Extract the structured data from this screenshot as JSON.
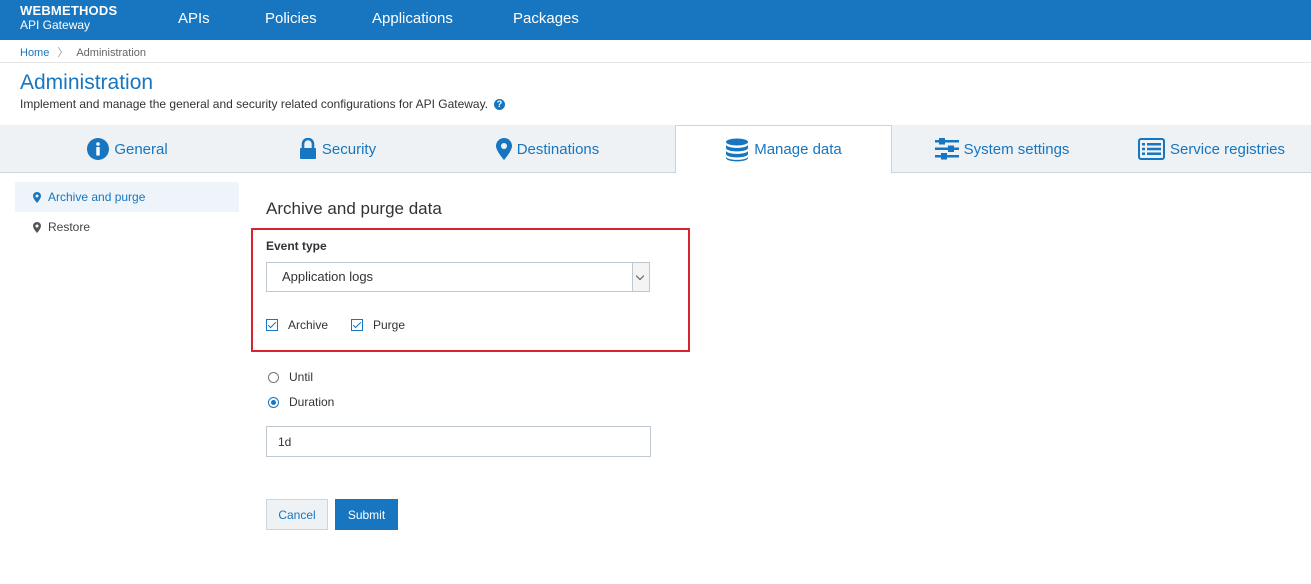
{
  "app": {
    "brand_line1": "WEBMETHODS",
    "brand_line2": "API Gateway"
  },
  "nav": {
    "items": [
      {
        "label": "APIs"
      },
      {
        "label": "Policies"
      },
      {
        "label": "Applications"
      },
      {
        "label": "Packages"
      }
    ]
  },
  "breadcrumb": {
    "home": "Home",
    "separator": "〉",
    "current": "Administration"
  },
  "page": {
    "title": "Administration",
    "description": "Implement and manage the general and security related configurations for API Gateway.",
    "help_icon": "?"
  },
  "tabs": [
    {
      "label": "General",
      "icon": "info-icon"
    },
    {
      "label": "Security",
      "icon": "lock-icon"
    },
    {
      "label": "Destinations",
      "icon": "map-pin-icon"
    },
    {
      "label": "Manage data",
      "icon": "database-icon",
      "active": true
    },
    {
      "label": "System settings",
      "icon": "sliders-icon"
    },
    {
      "label": "Service registries",
      "icon": "list-icon"
    }
  ],
  "sidebar": {
    "items": [
      {
        "label": "Archive and purge",
        "active": true
      },
      {
        "label": "Restore",
        "active": false
      }
    ]
  },
  "form": {
    "title": "Archive and purge data",
    "event_type_label": "Event type",
    "event_type_value": "Application logs",
    "archive_label": "Archive",
    "purge_label": "Purge",
    "until_label": "Until",
    "duration_label": "Duration",
    "duration_value": "1d",
    "cancel_label": "Cancel",
    "submit_label": "Submit"
  },
  "colors": {
    "primary": "#1776bf",
    "highlight": "#d9232e",
    "tab_bg": "#eef2f5"
  }
}
